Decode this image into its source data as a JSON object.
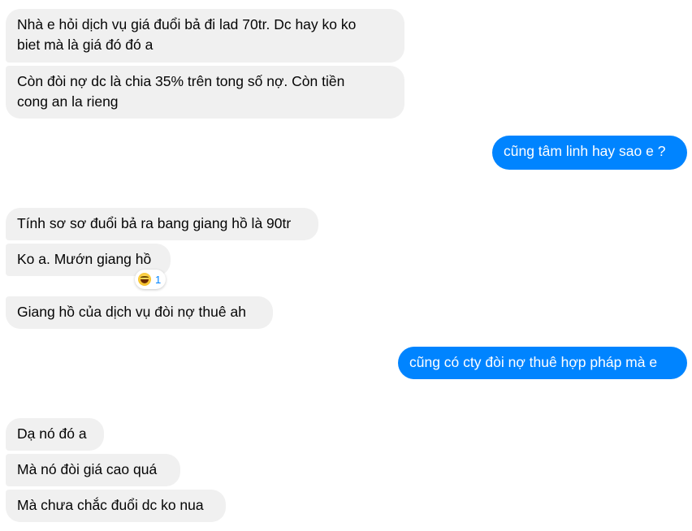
{
  "messages": [
    {
      "side": "in",
      "text": "Nhà e hỏi dịch vụ giá đuổi bả đi lad 70tr. Dc hay ko ko\nbiet mà là giá đó đó a"
    },
    {
      "side": "in",
      "text": "Còn đòi nợ dc là chia 35% trên tong số nợ. Còn tiền\ncong an la rieng"
    },
    {
      "side": "out",
      "text": "cũng tâm linh hay sao e ?"
    },
    {
      "side": "in",
      "text": "Tính sơ sơ đuổi bả ra bang giang hồ là 90tr"
    },
    {
      "side": "in",
      "text": "Ko a. Mướn giang hồ"
    },
    {
      "side": "in",
      "text": "Giang hồ của dịch vụ đòi nợ thuê ah"
    },
    {
      "side": "out",
      "text": "cũng có cty đòi nợ thuê hợp pháp mà e"
    },
    {
      "side": "in",
      "text": "Dạ nó đó a"
    },
    {
      "side": "in",
      "text": "Mà nó đòi giá cao quá"
    },
    {
      "side": "in",
      "text": "Mà chưa chắc đuổi dc ko nua"
    }
  ],
  "reaction": {
    "icon": "laughing-emoji-icon",
    "count": "1"
  },
  "colors": {
    "incoming_bg": "#f0f0f0",
    "outgoing_bg": "#0084ff"
  }
}
